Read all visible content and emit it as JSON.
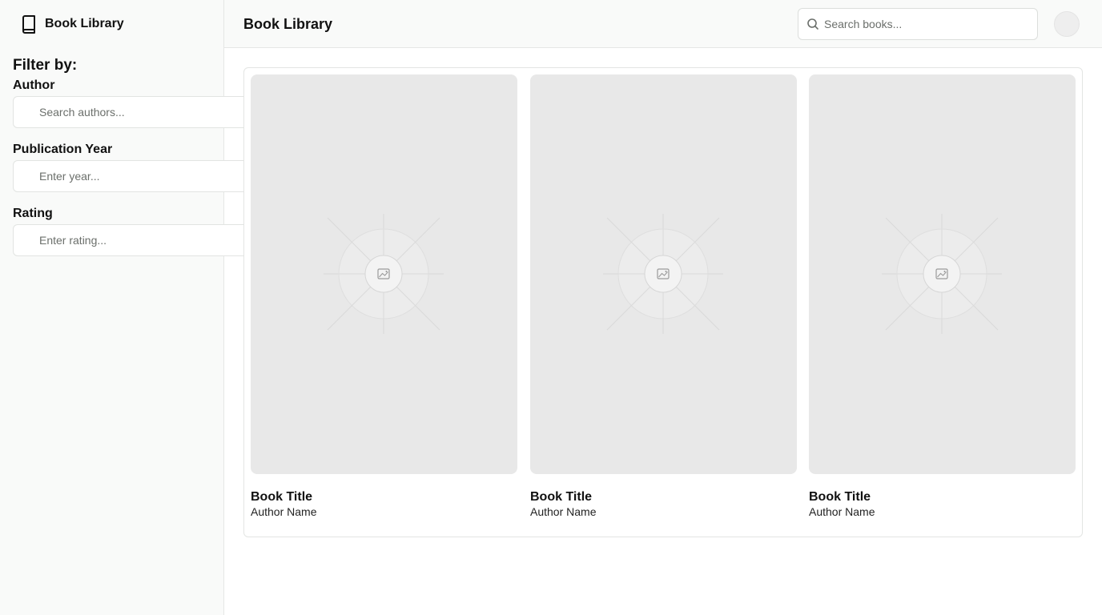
{
  "sidebar": {
    "brand": {
      "label": "Book Library",
      "icon": "book-icon"
    },
    "filter_heading": "Filter by:",
    "filters": [
      {
        "label": "Author",
        "placeholder": "Search authors...",
        "value": ""
      },
      {
        "label": "Publication Year",
        "placeholder": "Enter year...",
        "value": ""
      },
      {
        "label": "Rating",
        "placeholder": "Enter rating...",
        "value": ""
      }
    ]
  },
  "header": {
    "title": "Book Library",
    "search": {
      "placeholder": "Search books...",
      "value": "",
      "icon": "search-icon"
    },
    "avatar": {
      "icon": "avatar"
    }
  },
  "books": [
    {
      "title": "Book Title",
      "author": "Author Name",
      "cover_icon": "image-placeholder-icon"
    },
    {
      "title": "Book Title",
      "author": "Author Name",
      "cover_icon": "image-placeholder-icon"
    },
    {
      "title": "Book Title",
      "author": "Author Name",
      "cover_icon": "image-placeholder-icon"
    }
  ],
  "colors": {
    "sidebar_bg": "#f9faf9",
    "cover_bg": "#e8e8e8",
    "border": "#e5e7e5"
  }
}
